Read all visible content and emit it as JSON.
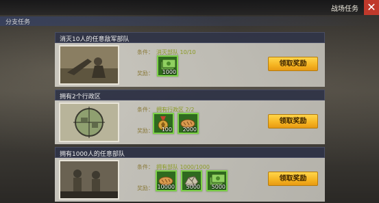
{
  "header": {
    "title": "战场任务"
  },
  "section": {
    "label": "分支任务"
  },
  "common": {
    "condition_label": "条件：",
    "reward_label": "奖励：",
    "claim_label": "领取奖励"
  },
  "missions": [
    {
      "title": "消灭10人的任意敌军部队",
      "condition": "消灭部队 10/10",
      "rewards": [
        {
          "icon": "cash-icon",
          "count": "1000"
        }
      ]
    },
    {
      "title": "拥有2个行政区",
      "condition": "拥有行政区 2/2",
      "rewards": [
        {
          "icon": "medal-icon",
          "count": "100"
        },
        {
          "icon": "bread-icon",
          "count": "2000"
        }
      ]
    },
    {
      "title": "拥有1000人的任意部队",
      "condition": "拥有部队 1000/1000",
      "rewards": [
        {
          "icon": "bread-icon",
          "count": "10000"
        },
        {
          "icon": "ore-icon",
          "count": "5000"
        },
        {
          "icon": "cash-icon",
          "count": "5000"
        }
      ]
    }
  ],
  "colors": {
    "reward_border": "#7fd24a",
    "claim_button": "#f5b321",
    "condition_text": "#8a9a22",
    "close_button": "#c0392b"
  }
}
